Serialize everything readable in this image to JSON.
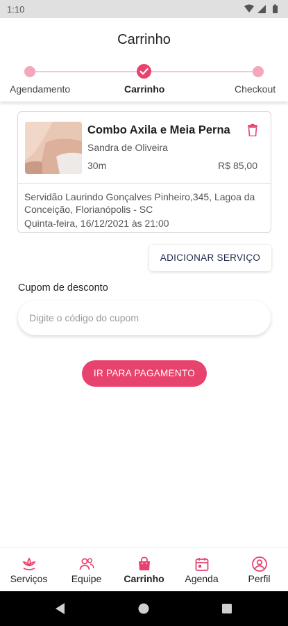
{
  "status_bar": {
    "time": "1:10"
  },
  "header": {
    "title": "Carrinho"
  },
  "stepper": {
    "steps": [
      {
        "label": "Agendamento"
      },
      {
        "label": "Carrinho"
      },
      {
        "label": "Checkout"
      }
    ]
  },
  "cart_item": {
    "name": "Combo Axila e Meia Perna",
    "professional": "Sandra de Oliveira",
    "duration": "30m",
    "price": "R$ 85,00",
    "address": "Servidão Laurindo Gonçalves Pinheiro,345, Lagoa da Conceição, Florianópolis - SC",
    "datetime": "Quinta-feira, 16/12/2021 às 21:00"
  },
  "add_service_label": "ADICIONAR SERVIÇO",
  "coupon": {
    "label": "Cupom de desconto",
    "placeholder": "Digite o código do cupom",
    "value": ""
  },
  "pay_button_label": "IR PARA PAGAMENTO",
  "bottom_nav": {
    "items": [
      {
        "label": "Serviços",
        "icon": "lotus-icon"
      },
      {
        "label": "Equipe",
        "icon": "team-icon"
      },
      {
        "label": "Carrinho",
        "icon": "shopping-bag-icon"
      },
      {
        "label": "Agenda",
        "icon": "calendar-icon"
      },
      {
        "label": "Perfil",
        "icon": "profile-icon"
      }
    ],
    "active": "Carrinho"
  },
  "colors": {
    "accent": "#e8436e",
    "accent_light": "#f4a8bc",
    "text_dark": "#222222",
    "text_muted": "#555555"
  }
}
